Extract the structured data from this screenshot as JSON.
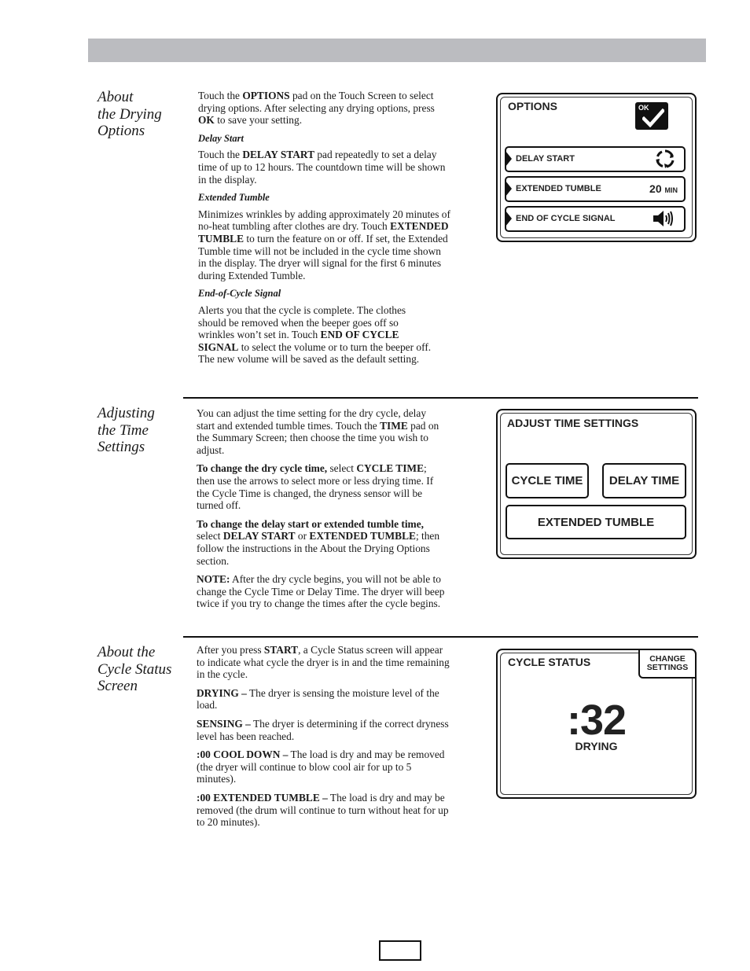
{
  "header": {
    "bar_color": "#bbbcc0"
  },
  "sections": {
    "drying_options": {
      "title_lines": [
        "About",
        "the Drying",
        "Options"
      ],
      "intro": {
        "t1": "Touch the ",
        "b1": "OPTIONS",
        "t2": " pad on the Touch Screen to select drying options. After selecting any drying options, press ",
        "b2": "OK",
        "t3": " to save your setting."
      },
      "delay_start": {
        "heading": "Delay Start",
        "t1": "Touch the ",
        "b1": "DELAY START",
        "t2": " pad repeatedly to set a delay time of up to 12 hours. The countdown time will be shown in the display."
      },
      "extended_tumble": {
        "heading": "Extended Tumble",
        "t1": "Minimizes wrinkles by adding approximately 20 minutes of no-heat tumbling after clothes are dry. Touch ",
        "b1": "EXTENDED TUMBLE",
        "t2": " to turn the feature on or off. If set, the Extended Tumble time will not be included in the cycle time shown in the display. The dryer will signal for the first 6 minutes during Extended Tumble."
      },
      "end_of_cycle": {
        "heading": "End-of-Cycle Signal",
        "t1": "Alerts you that the cycle is complete. The clothes should be removed when the beeper goes off so wrinkles won’t set in. Touch ",
        "b1": "END OF CYCLE SIGNAL",
        "t2": " to select the volume or to turn the beeper off. The new volume will be saved as the default setting."
      }
    },
    "adjust_time": {
      "title_lines": [
        "Adjusting",
        "the Time",
        "Settings"
      ],
      "intro": {
        "t1": "You can adjust the time setting for the dry cycle, delay start and extended tumble times. Touch the ",
        "b1": "TIME",
        "t2": " pad on the Summary Screen; then choose the time you wish to adjust."
      },
      "p2": {
        "b1": "To change the dry cycle time,",
        "t1": " select ",
        "b2": "CYCLE TIME",
        "t2": "; then use the arrows to select more or less drying time. If the Cycle Time is changed, the dryness sensor will be turned off."
      },
      "p3": {
        "b1": "To change the delay start or extended tumble time,",
        "t1": " select ",
        "b2": "DELAY START",
        "t2": " or ",
        "b3": "EXTENDED TUMBLE",
        "t3": "; then follow the instructions in the About the Drying Options section."
      },
      "p4": {
        "b1": "NOTE:",
        "t1": " After the dry cycle begins, you will not be able to change the Cycle Time or Delay Time. The dryer will beep twice if you try to change the times after the cycle begins."
      }
    },
    "cycle_status": {
      "title_lines": [
        "About the",
        "Cycle Status",
        "Screen"
      ],
      "intro": {
        "t1": "After you press ",
        "b1": "START",
        "t2": ", a Cycle Status screen will appear to indicate what cycle the dryer is in and the time remaining in the cycle."
      },
      "drying": {
        "b1": "DRYING –",
        "t1": " The dryer is sensing the moisture level of the load."
      },
      "sensing": {
        "b1": "SENSING –",
        "t1": " The dryer is determining if the correct dryness level has been reached."
      },
      "cool_down": {
        "b1": ":00 COOL DOWN –",
        "t1": " The load is dry and may be removed (the dryer will continue to blow cool air for up to 5 minutes)."
      },
      "ext_tumble": {
        "b1": ":00 EXTENDED TUMBLE –",
        "t1": " The load is dry and may be removed (the drum will continue to turn without heat for up to 20 minutes)."
      }
    }
  },
  "screens": {
    "options": {
      "title": "OPTIONS",
      "ok_label": "OK",
      "ok_icon": "checkmark-icon",
      "rows": [
        {
          "label": "DELAY START",
          "icon": "cycle-arrows-icon"
        },
        {
          "label": "EXTENDED TUMBLE",
          "value": "20",
          "unit": "MIN"
        },
        {
          "label": "END OF CYCLE SIGNAL",
          "icon": "speaker-volume-icon"
        }
      ]
    },
    "adjust_time": {
      "title": "ADJUST TIME SETTINGS",
      "buttons": [
        "CYCLE TIME",
        "DELAY TIME",
        "EXTENDED TUMBLE"
      ]
    },
    "cycle_status": {
      "title": "CYCLE STATUS",
      "change_line1": "CHANGE",
      "change_line2": "SETTINGS",
      "time": ":32",
      "status": "DRYING"
    }
  },
  "footer": {
    "page_number": ""
  }
}
